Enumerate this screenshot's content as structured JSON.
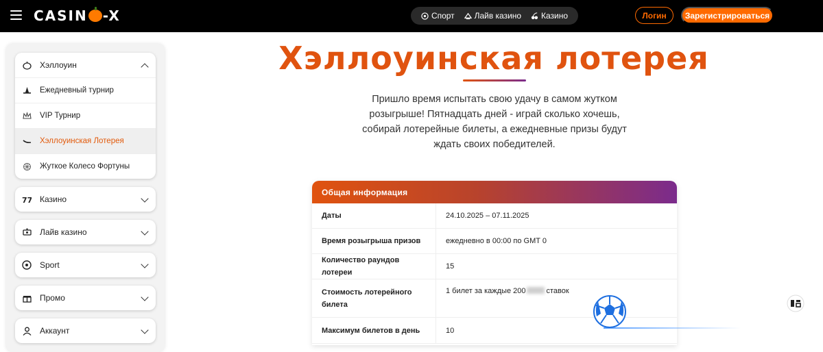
{
  "header": {
    "logo_text_1": "CASIN",
    "logo_text_2": "-X",
    "nav": [
      {
        "label": "Спорт",
        "icon": "soccer-icon"
      },
      {
        "label": "Лайв казино",
        "icon": "live-casino-icon"
      },
      {
        "label": "Казино",
        "icon": "cherries-icon"
      }
    ],
    "login_label": "Логин",
    "register_label": "Зарегистрироваться"
  },
  "sidebar": {
    "groups": [
      {
        "label": "Хэллоуин",
        "icon": "pumpkin-icon",
        "expanded": true,
        "items": [
          {
            "label": "Ежедневный турнир",
            "icon": "witch-hat-icon"
          },
          {
            "label": "VIP Турнир",
            "icon": "crown-icon"
          },
          {
            "label": "Хэллоуинская Лотерея",
            "icon": "broom-icon",
            "active": true
          },
          {
            "label": "Жуткое Колесо Фортуны",
            "icon": "wheel-icon"
          }
        ]
      },
      {
        "label": "Казино",
        "icon": "slot-icon",
        "expanded": false
      },
      {
        "label": "Лайв казино",
        "icon": "dealer-icon",
        "expanded": false
      },
      {
        "label": "Sport",
        "icon": "ball-icon",
        "expanded": false
      },
      {
        "label": "Промо",
        "icon": "gift-icon",
        "expanded": false
      },
      {
        "label": "Аккаунт",
        "icon": "user-icon",
        "expanded": false
      }
    ]
  },
  "main": {
    "title": "Хэллоуинская лотерея",
    "intro": "Пришло время испытать свою удачу в самом жутком розыгрыше! Пятнадцать дней - играй сколько хочешь, собирай лотерейные билеты, а ежедневные призы будут ждать своих победителей.",
    "info_card": {
      "title": "Общая информация",
      "rows": [
        {
          "key": "Даты",
          "value": "24.10.2025 – 07.11.2025"
        },
        {
          "key": "Время розыгрыша призов",
          "value": "ежедневно в 00:00 по GMT 0"
        },
        {
          "key": "Количество раундов лотереи",
          "value": "15"
        },
        {
          "key": "Стоимость лотерейного билета",
          "value_prefix": "1 билет за каждые 200",
          "value_suffix": "ставок"
        },
        {
          "key": "Максимум билетов в день",
          "value": "10"
        }
      ]
    }
  },
  "colors": {
    "accent": "#ff6a00",
    "title": "#e0530f",
    "gradient_end": "#7b2b8c",
    "topbar": "#000000"
  }
}
